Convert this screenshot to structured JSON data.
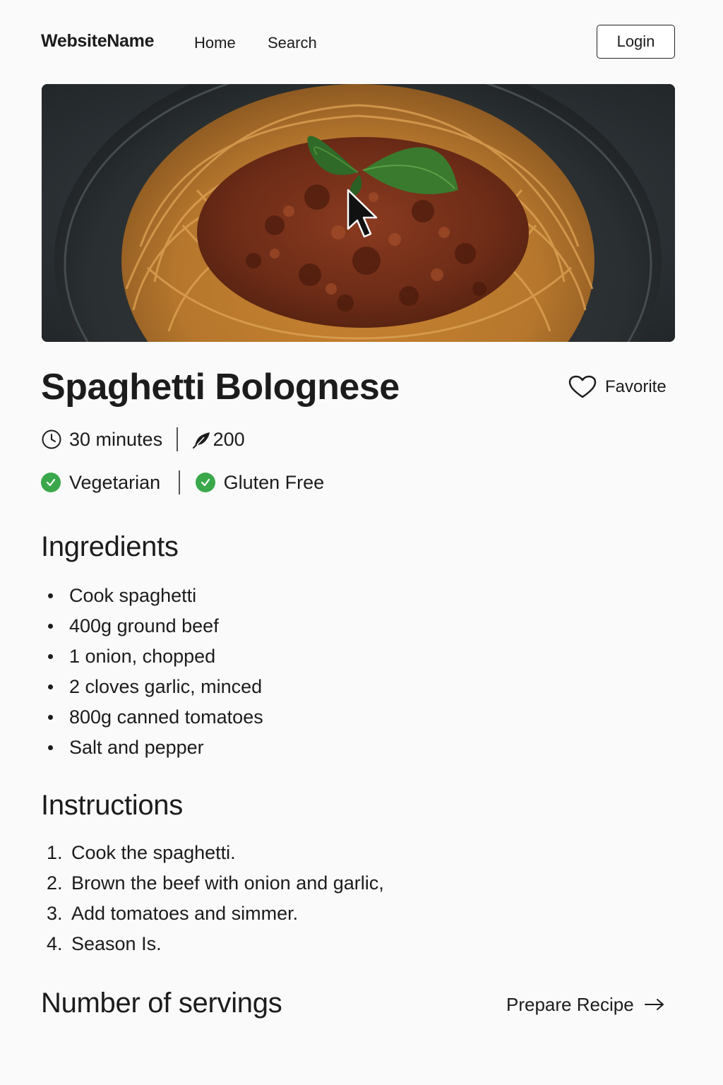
{
  "nav": {
    "brand": "WebsiteName",
    "links": [
      "Home",
      "Search"
    ],
    "login": "Login"
  },
  "recipe": {
    "title": "Spaghetti Bolognese",
    "favorite_label": "Favorite",
    "time": "30 minutes",
    "calories": "200",
    "tags": [
      "Vegetarian",
      "Gluten Free"
    ]
  },
  "ingredients": {
    "heading": "Ingredients",
    "items": [
      "Cook spaghetti",
      "400g ground beef",
      "1 onion, chopped",
      "2 cloves garlic, minced",
      "800g canned tomatoes",
      "Salt and pepper"
    ]
  },
  "instructions": {
    "heading": "Instructions",
    "steps": [
      "Cook the spaghetti.",
      "Brown the beef with onion and garlic,",
      "Add tomatoes and simmer.",
      "Season Is."
    ]
  },
  "servings": {
    "heading": "Number of servings"
  },
  "actions": {
    "prepare": "Prepare Recipe"
  },
  "icons": {
    "time": "clock-icon",
    "calories": "leaf-pen-icon",
    "favorite": "heart-icon",
    "tag": "check-circle-icon",
    "prepare": "arrow-right-icon",
    "cursor": "mouse-pointer-icon"
  },
  "colors": {
    "tag_check": "#3aa84a",
    "background": "#fafafa"
  }
}
